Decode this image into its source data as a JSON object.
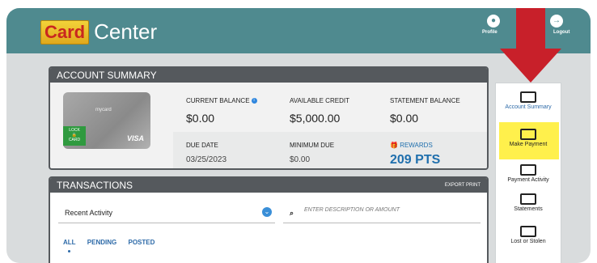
{
  "app": {
    "brand_card": "Card",
    "brand_center": "Center"
  },
  "header_nav": {
    "profile": "Profile",
    "logout": "Logout"
  },
  "account_summary": {
    "title": "ACCOUNT SUMMARY",
    "card_brand": "mycard",
    "card_lock": "LOCK",
    "card_card": "CARD",
    "card_network": "VISA",
    "current_balance_label": "CURRENT BALANCE",
    "current_balance_value": "$0.00",
    "available_credit_label": "AVAILABLE CREDIT",
    "available_credit_value": "$5,000.00",
    "statement_balance_label": "STATEMENT BALANCE",
    "statement_balance_value": "$0.00",
    "due_date_label": "DUE DATE",
    "due_date_value": "03/25/2023",
    "minimum_due_label": "MINIMUM DUE",
    "minimum_due_value": "$0.00",
    "rewards_label": "REWARDS",
    "rewards_value": "209 PTS"
  },
  "transactions": {
    "title": "TRANSACTIONS",
    "export_print": "EXPORT PRINT",
    "filter_value": "Recent Activity",
    "search_placeholder": "ENTER DESCRIPTION OR AMOUNT",
    "tabs": [
      "ALL",
      "PENDING",
      "POSTED"
    ]
  },
  "sidebar": {
    "items": [
      {
        "label": "Account Summary",
        "icon": "card-home-icon"
      },
      {
        "label": "Make Payment",
        "icon": "card-dollar-icon"
      },
      {
        "label": "Payment Activity",
        "icon": "calendar-dollar-icon"
      },
      {
        "label": "Statements",
        "icon": "statements-icon"
      },
      {
        "label": "Lost or Stolen",
        "icon": "card-warning-icon"
      }
    ]
  },
  "colors": {
    "header": "#4f8a8f",
    "panel_header": "#55595d",
    "accent": "#2d6aa8",
    "highlight": "#fff04c",
    "arrow": "#c8202a"
  }
}
